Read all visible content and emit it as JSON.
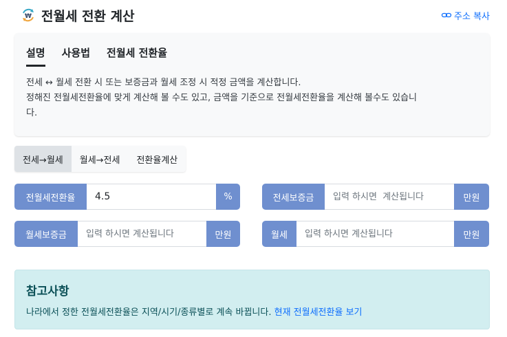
{
  "header": {
    "title": "전월세 전환 계산",
    "icon": "won-exchange-icon",
    "copy_label": "주소 복사"
  },
  "info": {
    "tabs": [
      {
        "label": "설명",
        "active": true
      },
      {
        "label": "사용법",
        "active": false
      },
      {
        "label": "전월세 전환율",
        "active": false
      }
    ],
    "description_line1": "전세 ↔ 월세 전환 시 또는 보증금과 월세 조정 시 적정 금액을 계산합니다.",
    "description_line2": "정해진 전월세전환율에 맞게 계산해 볼 수도 있고, 금액을 기준으로 전월세전환율을 계산해 볼수도 있습니",
    "description_line3": "다."
  },
  "modes": [
    {
      "label": "전세→월세",
      "active": true
    },
    {
      "label": "월세→전세",
      "active": false
    },
    {
      "label": "전환율계산",
      "active": false
    }
  ],
  "fields": {
    "rate": {
      "label": "전월세전환율",
      "value": "4.5",
      "unit": "%"
    },
    "jeonse_deposit": {
      "label": "전세보증금",
      "placeholder": "입력 하시면  계산됩니다",
      "unit": "만원"
    },
    "monthly_deposit": {
      "label": "월세보증금",
      "placeholder": "입력 하시면 계산됩니다",
      "unit": "만원"
    },
    "monthly_rent": {
      "label": "월세",
      "placeholder": "입력 하시면 계산됩니다",
      "unit": "만원"
    }
  },
  "note": {
    "title": "참고사항",
    "text": "나라에서 정한 전월세전환율은 지역/시기/종류별로 계속 바뀝니다.",
    "link_label": "현재 전월세전환율 보기"
  },
  "colors": {
    "addon": "#6f8fcf",
    "link": "#0d6efd",
    "note_bg": "#d2eef0"
  }
}
